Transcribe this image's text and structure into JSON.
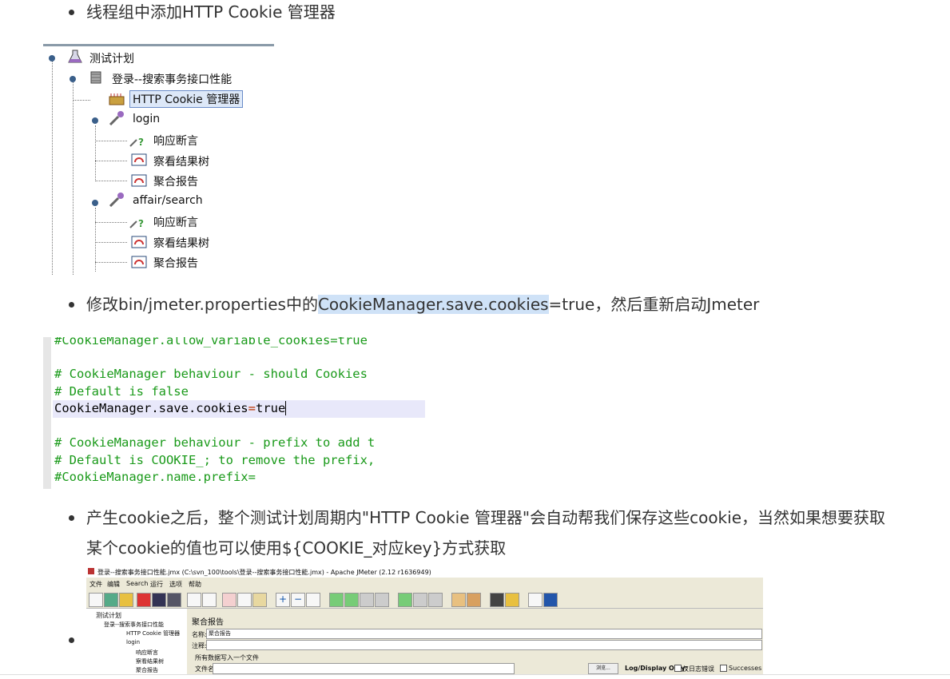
{
  "bullets": [
    "线程组中添加HTTP Cookie 管理器",
    "修改bin/jmeter.properties中的",
    "CookieManager.save.cookies",
    "=true，然后重新启动Jmeter",
    "产生cookie之后，整个测试计划周期内\"HTTP Cookie 管理器\"会自动帮我们保存这些cookie，当然如果想要获取",
    "某个cookie的值也可以使用${COOKIE_对应key}方式获取"
  ],
  "tree": {
    "items": [
      "测试计划",
      "登录--搜索事务接口性能",
      "HTTP Cookie 管理器",
      "login",
      "响应断言",
      "察看结果树",
      "聚合报告",
      "affair/search",
      "响应断言",
      "察看结果树",
      "聚合报告"
    ]
  },
  "code": {
    "lines": [
      "#CookieManager.allow_variable_cookies=true",
      "",
      "# CookieManager behaviour - should Cookies",
      "# Default is false",
      "CookieManager.save.cookies=true",
      "",
      "# CookieManager behaviour - prefix to add t",
      "# Default is COOKIE_; to remove the prefix,",
      "#CookieManager.name.prefix="
    ]
  },
  "jmeter": {
    "title": "登录--搜索事务接口性能.jmx (C:\\svn_100\\tools\\登录--搜索事务接口性能.jmx) - Apache JMeter (2.12 r1636949)",
    "menu": [
      "文件",
      "编辑",
      "Search",
      "运行",
      "选项",
      "帮助"
    ],
    "tree": [
      "测试计划",
      "登录--搜索事务接口性能",
      "HTTP Cookie 管理器",
      "login",
      "响应断言",
      "察看结果树",
      "聚合报告"
    ],
    "panel_title": "聚合报告",
    "name_label": "名称:",
    "name_value": "聚合报告",
    "comment_label": "注释:",
    "section": "所有数据写入一个文件",
    "file_label": "文件名",
    "browse": "浏览...",
    "log_label": "Log/Display Only:",
    "errors_label": "仅日志错误",
    "successes_label": "Successes"
  }
}
